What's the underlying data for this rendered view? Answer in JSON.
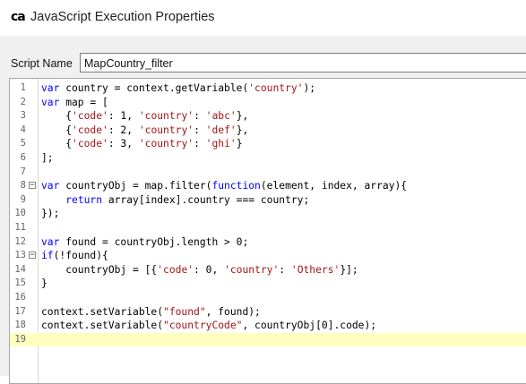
{
  "window": {
    "logo_text": "ca",
    "title": "JavaScript Execution Properties"
  },
  "form": {
    "script_name_label": "Script Name",
    "script_name_value": "MapCountry_filter"
  },
  "editor": {
    "current_line": 19,
    "fold_markers": [
      8,
      13
    ],
    "lines": [
      [
        [
          "kw",
          "var"
        ],
        [
          "t",
          " country = context.getVariable("
        ],
        [
          "str",
          "'country'"
        ],
        [
          "t",
          ");"
        ]
      ],
      [
        [
          "kw",
          "var"
        ],
        [
          "t",
          " map = ["
        ]
      ],
      [
        [
          "t",
          "    {"
        ],
        [
          "str",
          "'code'"
        ],
        [
          "t",
          ": 1, "
        ],
        [
          "str",
          "'country'"
        ],
        [
          "t",
          ": "
        ],
        [
          "str",
          "'abc'"
        ],
        [
          "t",
          "},"
        ]
      ],
      [
        [
          "t",
          "    {"
        ],
        [
          "str",
          "'code'"
        ],
        [
          "t",
          ": 2, "
        ],
        [
          "str",
          "'country'"
        ],
        [
          "t",
          ": "
        ],
        [
          "str",
          "'def'"
        ],
        [
          "t",
          "},"
        ]
      ],
      [
        [
          "t",
          "    {"
        ],
        [
          "str",
          "'code'"
        ],
        [
          "t",
          ": 3, "
        ],
        [
          "str",
          "'country'"
        ],
        [
          "t",
          ": "
        ],
        [
          "str",
          "'ghi'"
        ],
        [
          "t",
          "}"
        ]
      ],
      [
        [
          "t",
          "];"
        ]
      ],
      [],
      [
        [
          "kw",
          "var"
        ],
        [
          "t",
          " countryObj = map.filter("
        ],
        [
          "kw",
          "function"
        ],
        [
          "t",
          "(element, index, array){"
        ]
      ],
      [
        [
          "t",
          "    "
        ],
        [
          "kw",
          "return"
        ],
        [
          "t",
          " array[index].country === country;"
        ]
      ],
      [
        [
          "t",
          "});"
        ]
      ],
      [],
      [
        [
          "kw",
          "var"
        ],
        [
          "t",
          " found = countryObj.length > 0;"
        ]
      ],
      [
        [
          "kw",
          "if"
        ],
        [
          "t",
          "(!found){"
        ]
      ],
      [
        [
          "t",
          "    countryObj = [{"
        ],
        [
          "str",
          "'code'"
        ],
        [
          "t",
          ": 0, "
        ],
        [
          "str",
          "'country'"
        ],
        [
          "t",
          ": "
        ],
        [
          "str",
          "'Others'"
        ],
        [
          "t",
          "}];"
        ]
      ],
      [
        [
          "t",
          "}"
        ]
      ],
      [],
      [
        [
          "t",
          "context.setVariable("
        ],
        [
          "str",
          "\"found\""
        ],
        [
          "t",
          ", found);"
        ]
      ],
      [
        [
          "t",
          "context.setVariable("
        ],
        [
          "str",
          "\"countryCode\""
        ],
        [
          "t",
          ", countryObj[0].code);"
        ]
      ],
      []
    ]
  }
}
